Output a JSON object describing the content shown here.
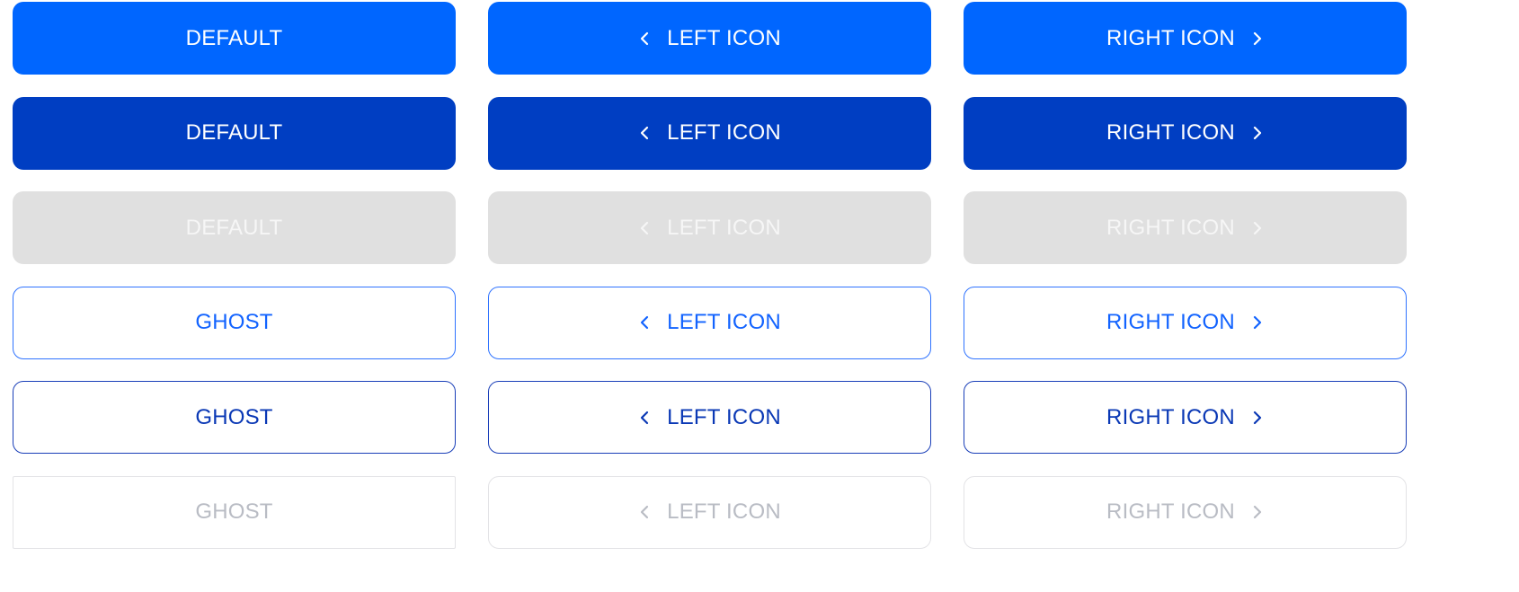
{
  "rows": [
    {
      "variant": "primary",
      "buttons": [
        {
          "label": "DEFAULT"
        },
        {
          "label": "LEFT ICON",
          "icon": "chevron-left-icon"
        },
        {
          "label": "RIGHT ICON",
          "icon": "chevron-right-icon"
        }
      ]
    },
    {
      "variant": "primary-hover",
      "buttons": [
        {
          "label": "DEFAULT"
        },
        {
          "label": "LEFT ICON",
          "icon": "chevron-left-icon"
        },
        {
          "label": "RIGHT ICON",
          "icon": "chevron-right-icon"
        }
      ]
    },
    {
      "variant": "primary-disabled",
      "buttons": [
        {
          "label": "DEFAULT"
        },
        {
          "label": "LEFT ICON",
          "icon": "chevron-left-icon"
        },
        {
          "label": "RIGHT ICON",
          "icon": "chevron-right-icon"
        }
      ]
    },
    {
      "variant": "ghost",
      "buttons": [
        {
          "label": "GHOST"
        },
        {
          "label": "LEFT ICON",
          "icon": "chevron-left-icon"
        },
        {
          "label": "RIGHT ICON",
          "icon": "chevron-right-icon"
        }
      ]
    },
    {
      "variant": "ghost-hover",
      "buttons": [
        {
          "label": "GHOST"
        },
        {
          "label": "LEFT ICON",
          "icon": "chevron-left-icon"
        },
        {
          "label": "RIGHT ICON",
          "icon": "chevron-right-icon"
        }
      ]
    },
    {
      "variant": "ghost-disabled",
      "buttons": [
        {
          "label": "GHOST"
        },
        {
          "label": "LEFT ICON",
          "icon": "chevron-left-icon"
        },
        {
          "label": "RIGHT ICON",
          "icon": "chevron-right-icon"
        }
      ]
    }
  ],
  "colors": {
    "primary": "#0066ff",
    "primary_hover": "#003ec2",
    "disabled_bg": "#e0e0e0",
    "ghost_text": "#1263ff",
    "ghost_hover_text": "#0a38b5",
    "ghost_disabled_text": "#b9bcc4"
  }
}
